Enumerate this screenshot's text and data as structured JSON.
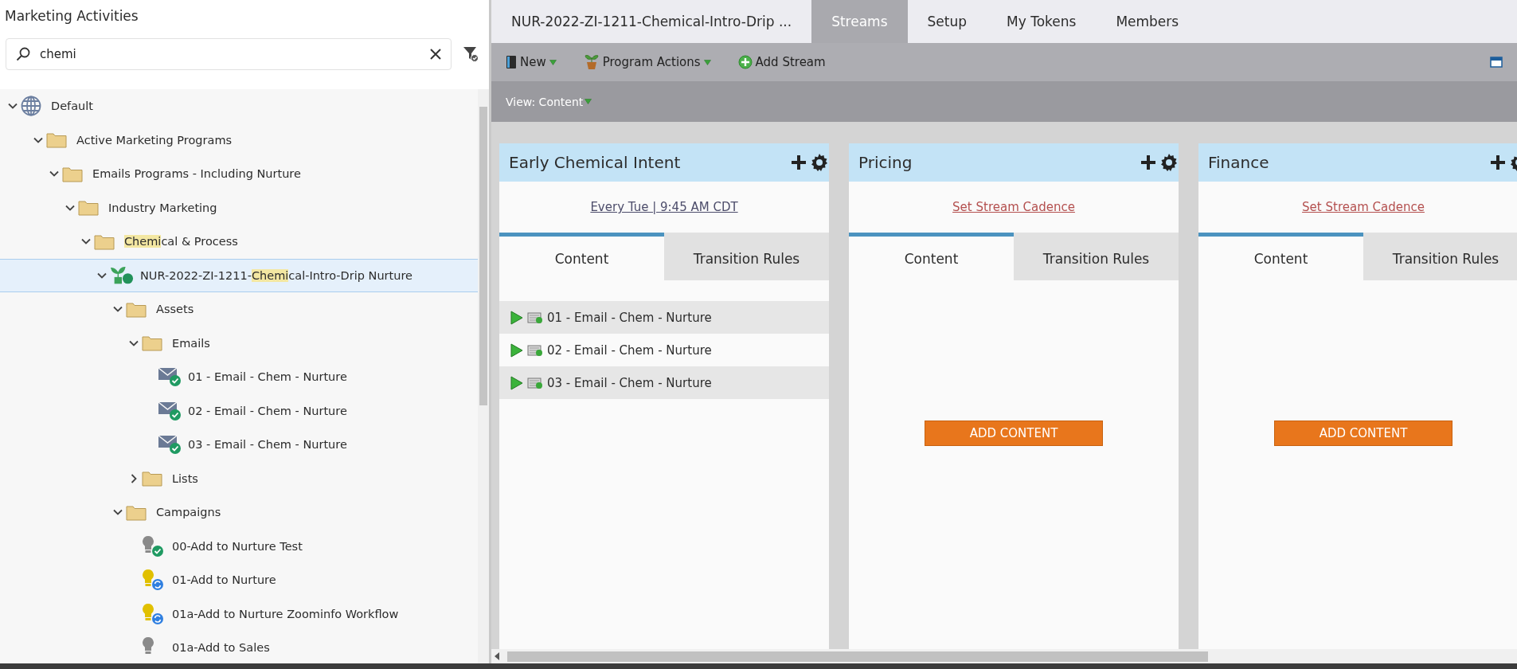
{
  "left_panel": {
    "title": "Marketing Activities",
    "search": {
      "value": "chemi"
    }
  },
  "tree": [
    {
      "label": "Default",
      "kind": "workspace",
      "expanded": true,
      "selected": false,
      "children": [
        {
          "label": "Active Marketing Programs",
          "kind": "folder",
          "expanded": true,
          "selected": false,
          "children": [
            {
              "label": "Emails Programs - Including Nurture",
              "kind": "folder",
              "expanded": true,
              "selected": false,
              "children": [
                {
                  "label": "Industry Marketing",
                  "kind": "folder",
                  "expanded": true,
                  "selected": false,
                  "children": [
                    {
                      "label_parts": [
                        {
                          "text": "Chemi",
                          "match": true
                        },
                        {
                          "text": "cal & Process",
                          "match": false
                        }
                      ],
                      "kind": "folder",
                      "expanded": true,
                      "selected": false,
                      "children": [
                        {
                          "label_parts": [
                            {
                              "text": "NUR-2022-ZI-1211-",
                              "match": false
                            },
                            {
                              "text": "Chemi",
                              "match": true
                            },
                            {
                              "text": "cal-Intro-Drip Nurture",
                              "match": false
                            }
                          ],
                          "kind": "program",
                          "expanded": true,
                          "selected": true,
                          "children": [
                            {
                              "label": "Assets",
                              "kind": "folder",
                              "expanded": true,
                              "selected": false,
                              "children": [
                                {
                                  "label": "Emails",
                                  "kind": "folder",
                                  "expanded": true,
                                  "selected": false,
                                  "children": [
                                    {
                                      "label": "01 - Email - Chem - Nurture",
                                      "kind": "email",
                                      "selected": false
                                    },
                                    {
                                      "label": "02 - Email - Chem - Nurture",
                                      "kind": "email",
                                      "selected": false
                                    },
                                    {
                                      "label": "03 - Email - Chem - Nurture",
                                      "kind": "email",
                                      "selected": false
                                    }
                                  ]
                                },
                                {
                                  "label": "Lists",
                                  "kind": "folder",
                                  "expanded": false,
                                  "selected": false
                                }
                              ]
                            },
                            {
                              "label": "Campaigns",
                              "kind": "folder",
                              "expanded": true,
                              "selected": false,
                              "children": [
                                {
                                  "label": "00-Add to Nurture Test",
                                  "kind": "campaign-approved",
                                  "selected": false
                                },
                                {
                                  "label": "01-Add to Nurture",
                                  "kind": "campaign-active",
                                  "selected": false
                                },
                                {
                                  "label": "01a-Add to Nurture Zoominfo Workflow",
                                  "kind": "campaign-active",
                                  "selected": false
                                },
                                {
                                  "label": "01a-Add to Sales",
                                  "kind": "campaign-inactive",
                                  "selected": false
                                }
                              ]
                            }
                          ]
                        }
                      ]
                    }
                  ]
                }
              ]
            }
          ]
        }
      ]
    }
  ],
  "tabs": [
    {
      "label": "NUR-2022-ZI-1211-Chemical-Intro-Drip ...",
      "selected": false
    },
    {
      "label": "Streams",
      "selected": true
    },
    {
      "label": "Setup",
      "selected": false
    },
    {
      "label": "My Tokens",
      "selected": false
    },
    {
      "label": "Members",
      "selected": false
    }
  ],
  "toolbar": [
    {
      "label": "New",
      "kind": "new",
      "dropdown": true
    },
    {
      "label": "Program Actions",
      "kind": "actions",
      "dropdown": true
    },
    {
      "label": "Add Stream",
      "kind": "add",
      "dropdown": false
    }
  ],
  "view": {
    "label": "View: Content"
  },
  "streams": [
    {
      "title": "Early Chemical Intent",
      "cadence": {
        "text": "Every Tue | 9:45 AM CDT",
        "kind": "scheduled"
      },
      "tabs": [
        {
          "label": "Content",
          "selected": true
        },
        {
          "label": "Transition Rules",
          "selected": false
        }
      ],
      "items": [
        {
          "label": "01 - Email - Chem - Nurture"
        },
        {
          "label": "02 - Email - Chem - Nurture"
        },
        {
          "label": "03 - Email - Chem - Nurture"
        }
      ]
    },
    {
      "title": "Pricing",
      "cadence": {
        "text": "Set Stream Cadence",
        "kind": "prompt"
      },
      "tabs": [
        {
          "label": "Content",
          "selected": true
        },
        {
          "label": "Transition Rules",
          "selected": false
        }
      ],
      "add_button": "ADD CONTENT"
    },
    {
      "title": "Finance",
      "cadence": {
        "text": "Set Stream Cadence",
        "kind": "prompt"
      },
      "tabs": [
        {
          "label": "Content",
          "selected": true
        },
        {
          "label": "Transition Rules",
          "selected": false
        }
      ],
      "add_button": "ADD CONTENT"
    }
  ]
}
